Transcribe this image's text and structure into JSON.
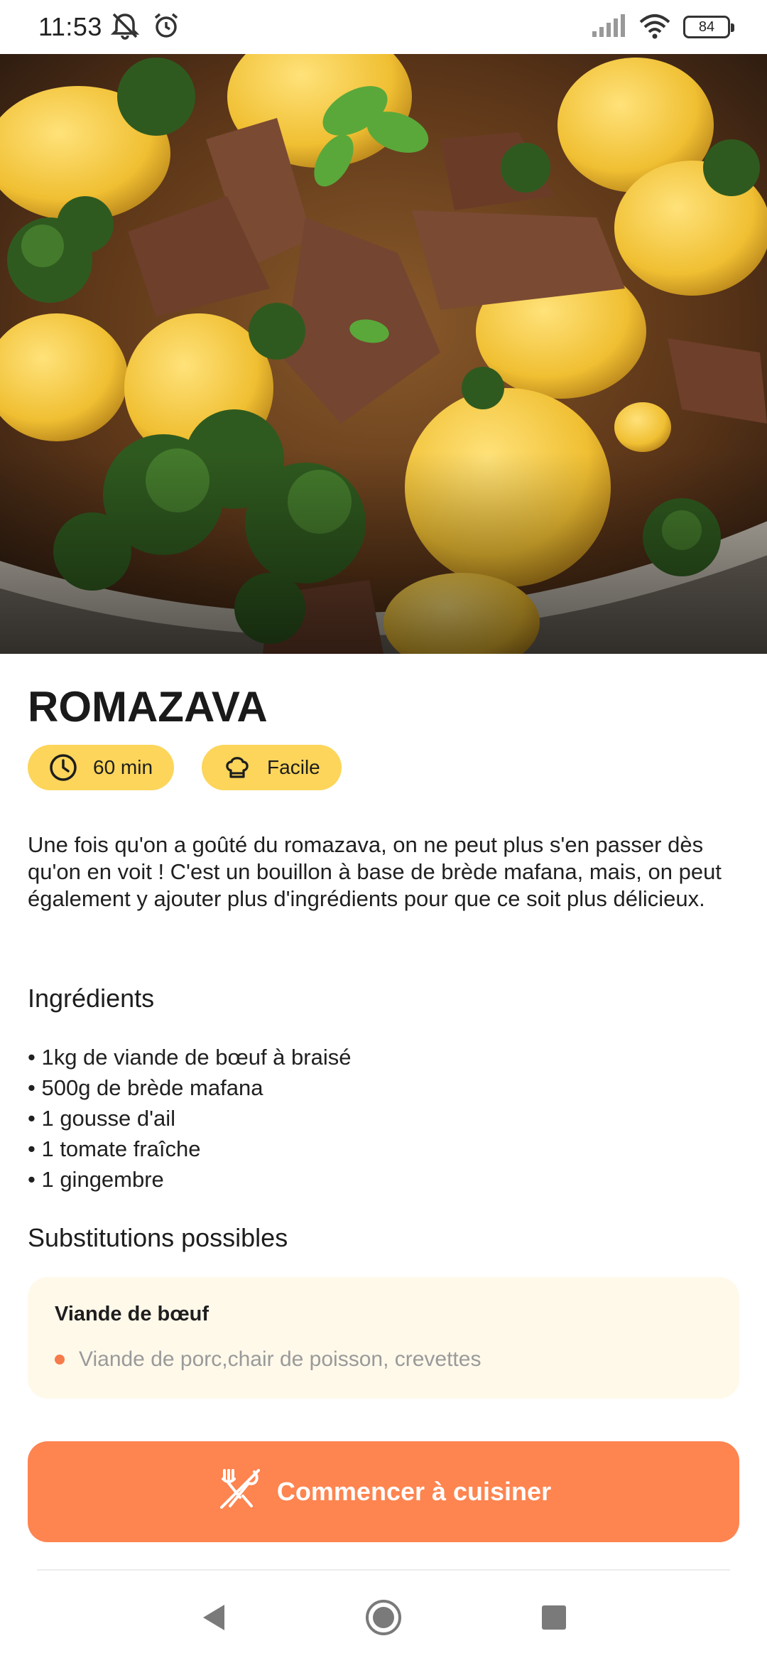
{
  "status_bar": {
    "time": "11:53",
    "battery": "84",
    "icons": [
      "notifications-muted-icon",
      "alarm-icon",
      "signal-icon",
      "wifi-icon",
      "battery-icon"
    ]
  },
  "hero": {
    "image": "romazava-stew-photo"
  },
  "recipe": {
    "title": "ROMAZAVA",
    "duration": "60 min",
    "difficulty": "Facile",
    "description": "Une fois qu'on a goûté du romazava, on ne peut plus s'en passer dès qu'on en voit ! C'est un bouillon à base de brède mafana, mais, on peut également y ajouter plus d'ingrédients pour que ce soit plus délicieux."
  },
  "ingredients": {
    "title": "Ingrédients",
    "items": [
      "• 1kg de viande de bœuf à braisé",
      "• 500g de brède mafana",
      "• 1 gousse d'ail",
      "• 1 tomate fraîche",
      "• 1 gingembre"
    ]
  },
  "substitutions": {
    "title": "Substitutions possibles",
    "items": [
      {
        "name": "Viande de bœuf",
        "alternatives": "Viande de porc,chair de poisson, crevettes"
      }
    ]
  },
  "cta": {
    "label": "Commencer à cuisiner",
    "icon": "utensils-crossed-icon"
  },
  "colors": {
    "chip_bg": "#fcd55a",
    "cta_bg": "#fe8450",
    "subs_card_bg": "#fff9ea",
    "subs_dot": "#f57c4a"
  }
}
